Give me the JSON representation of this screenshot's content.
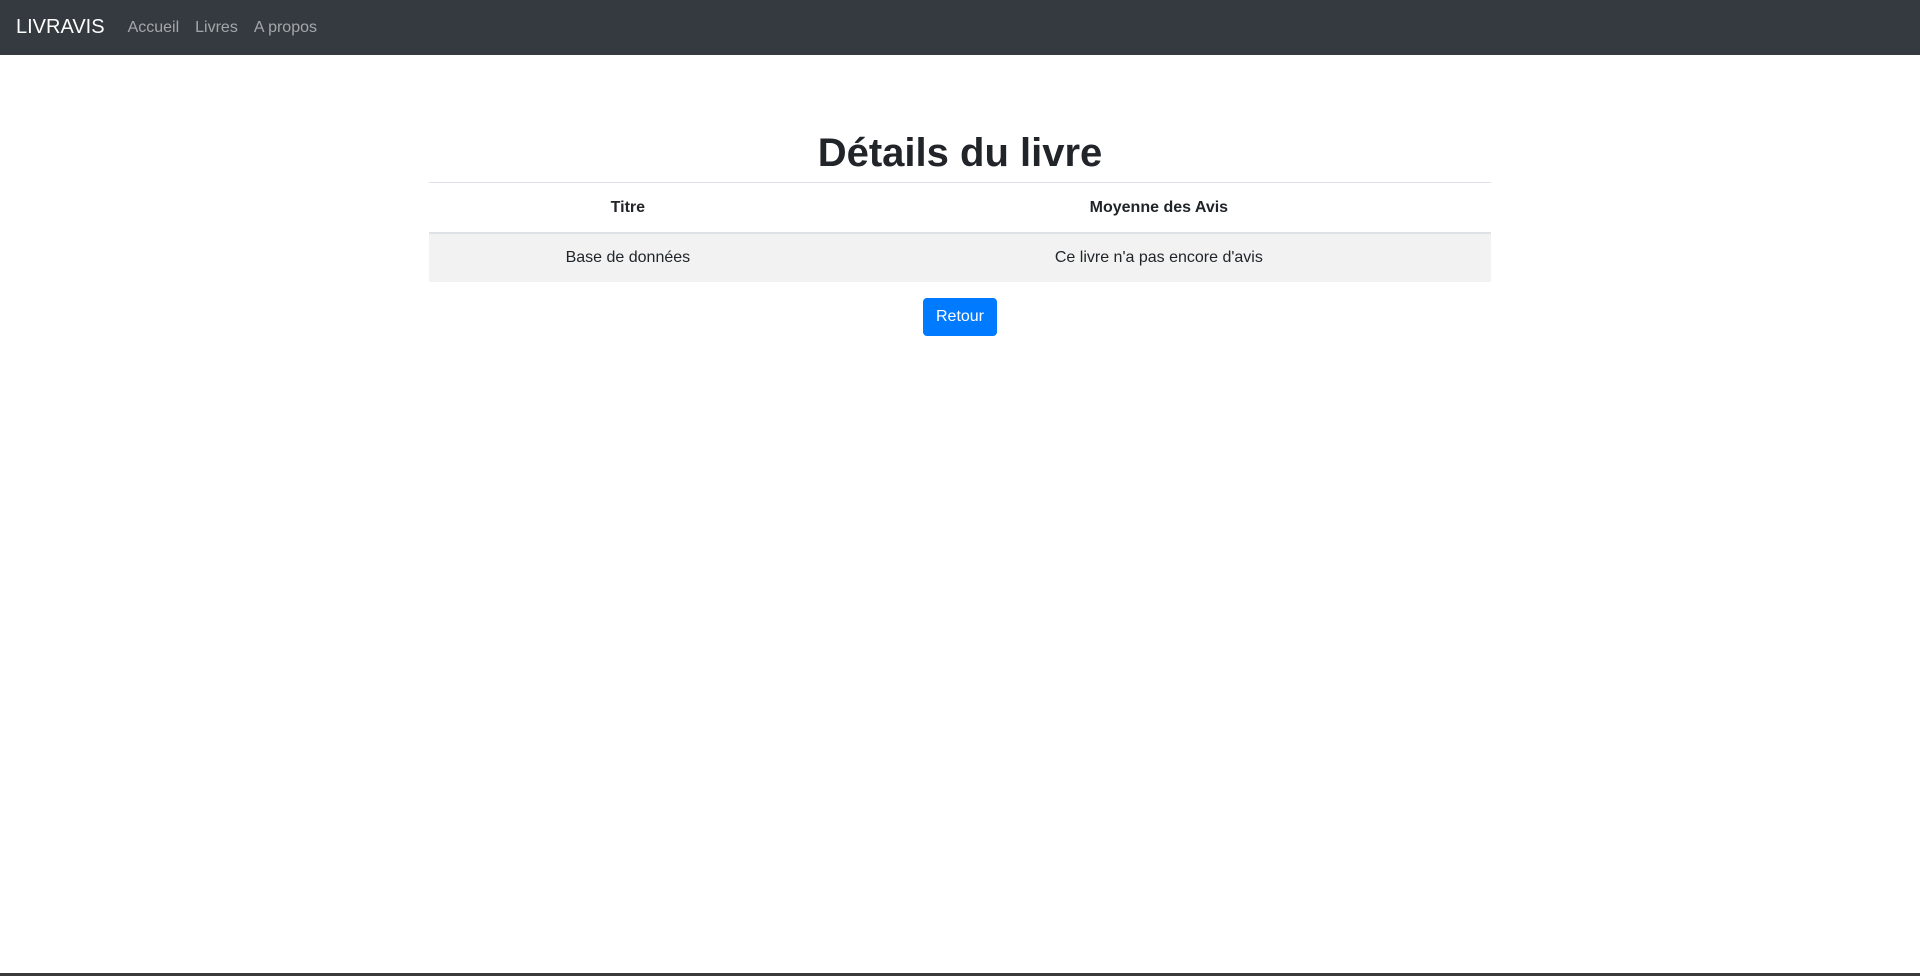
{
  "navbar": {
    "brand": "LIVRAVIS",
    "links": [
      {
        "label": "Accueil"
      },
      {
        "label": "Livres"
      },
      {
        "label": "A propos"
      }
    ]
  },
  "main": {
    "title": "Détails du livre",
    "table": {
      "headers": [
        "Titre",
        "Moyenne des Avis"
      ],
      "rows": [
        [
          "Base de données",
          "Ce livre n'a pas encore d'avis"
        ]
      ]
    },
    "back_button_label": "Retour"
  },
  "colors": {
    "navbar_bg": "#343a40",
    "primary": "#007bff",
    "row_bg": "#f2f2f2"
  }
}
